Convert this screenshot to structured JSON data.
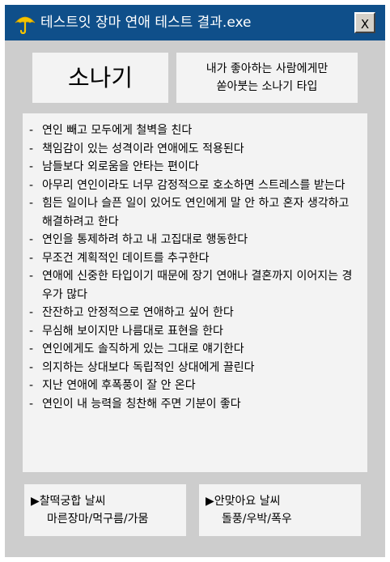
{
  "window": {
    "title": "테스트잇 장마 연애 테스트 결과.exe",
    "close_label": "X",
    "icon": "umbrella-icon"
  },
  "result": {
    "type_name": "소나기",
    "description": [
      "내가 좋아하는 사람에게만",
      "쏟아붓는 소나기 타입"
    ]
  },
  "traits": [
    "연인 빼고 모두에게 철벽을 친다",
    "책임감이 있는 성격이라 연애에도 적용된다",
    "남들보다 외로움을 안타는 편이다",
    "아무리 연인이라도 너무 감정적으로 호소하면 스트레스를 받는다",
    "힘든 일이나 슬픈 일이 있어도 연인에게 말 안 하고 혼자 생각하고 해결하려고 한다",
    "연인을 통제하려 하고 내 고집대로 행동한다",
    "무조건 계획적인 데이트를 추구한다",
    "연애에 신중한 타입이기 때문에 장기 연애나 결혼까지 이어지는 경우가 많다",
    "잔잔하고 안정적으로 연애하고 싶어 한다",
    "무심해 보이지만 나름대로 표현을 한다",
    "연인에게도 솔직하게 있는 그대로 얘기한다",
    "의지하는 상대보다 독립적인 상대에게 끌린다",
    "지난 연애에 후폭풍이 잘 안 온다",
    "연인이 내 능력을 칭찬해 주면 기분이 좋다"
  ],
  "weather": {
    "good": {
      "label": "▶찰떡궁합 날씨",
      "value": "마른장마/먹구름/가뭄"
    },
    "bad": {
      "label": "▶안맞아요 날씨",
      "value": "돌풍/우박/폭우"
    }
  },
  "colors": {
    "titlebar": "#0f4f8a",
    "window_bg": "#cdcdcd",
    "panel_bg": "#f3f3f3",
    "umbrella": "#f5c400"
  }
}
